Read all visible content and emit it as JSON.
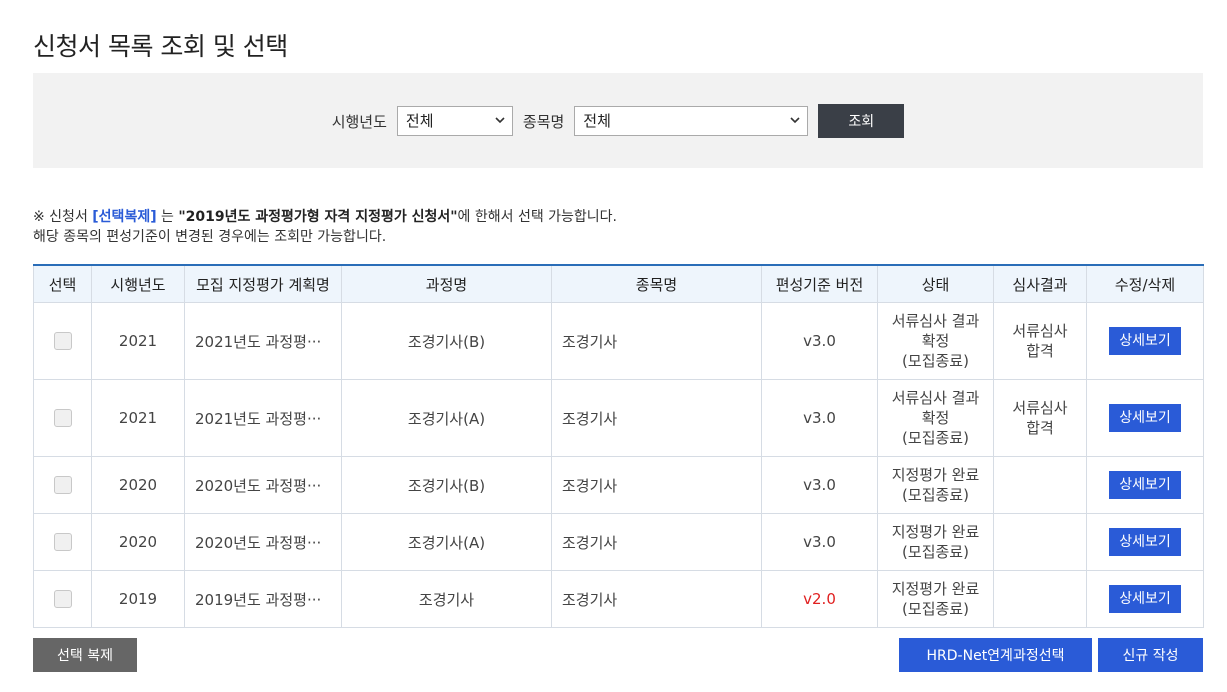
{
  "page": {
    "title": "신청서 목록 조회 및 선택"
  },
  "search": {
    "year_label": "시행년도",
    "year_value": "전체",
    "item_label": "종목명",
    "item_value": "전체",
    "search_button": "조회"
  },
  "notice": {
    "line1_prefix": "※ 신청서 ",
    "line1_highlight": "[선택복제]",
    "line1_mid": " 는 ",
    "line1_bold": "\"2019년도 과정평가형 자격 지정평가 신청서\"",
    "line1_suffix": "에 한해서 선택 가능합니다.",
    "line2": "해당 종목의 편성기준이 변경된 경우에는 조회만 가능합니다."
  },
  "table": {
    "headers": [
      "선택",
      "시행년도",
      "모집 지정평가 계획명",
      "과정명",
      "종목명",
      "편성기준 버전",
      "상태",
      "심사결과",
      "수정/삭제"
    ],
    "rows": [
      {
        "year": "2021",
        "plan": "2021년도 과정평···",
        "course": "조경기사(B)",
        "item": "조경기사",
        "version": "v3.0",
        "status1": "서류심사 결과",
        "status2": "확정",
        "status3": "(모집종료)",
        "result1": "서류심사",
        "result2": "합격",
        "action": "상세보기"
      },
      {
        "year": "2021",
        "plan": "2021년도 과정평···",
        "course": "조경기사(A)",
        "item": "조경기사",
        "version": "v3.0",
        "status1": "서류심사 결과",
        "status2": "확정",
        "status3": "(모집종료)",
        "result1": "서류심사",
        "result2": "합격",
        "action": "상세보기"
      },
      {
        "year": "2020",
        "plan": "2020년도 과정평···",
        "course": "조경기사(B)",
        "item": "조경기사",
        "version": "v3.0",
        "status1": "지정평가 완료",
        "status2": "(모집종료)",
        "action": "상세보기"
      },
      {
        "year": "2020",
        "plan": "2020년도 과정평···",
        "course": "조경기사(A)",
        "item": "조경기사",
        "version": "v3.0",
        "status1": "지정평가 완료",
        "status2": "(모집종료)",
        "action": "상세보기"
      },
      {
        "year": "2019",
        "plan": "2019년도 과정평···",
        "course": "조경기사",
        "item": "조경기사",
        "version": "v2.0",
        "status1": "지정평가 완료",
        "status2": "(모집종료)",
        "action": "상세보기"
      }
    ]
  },
  "footer": {
    "copy_button": "선택 복제",
    "hrd_button": "HRD-Net연계과정선택",
    "new_button": "신규 작성"
  },
  "colors": {
    "primary": "#2a5bd7",
    "dark_button": "#3a3f47",
    "gray_button": "#666666",
    "header_bg": "#eef5fc",
    "version_warning": "#e02020"
  },
  "icons": {
    "select_arrow": "chevron-down-icon"
  }
}
